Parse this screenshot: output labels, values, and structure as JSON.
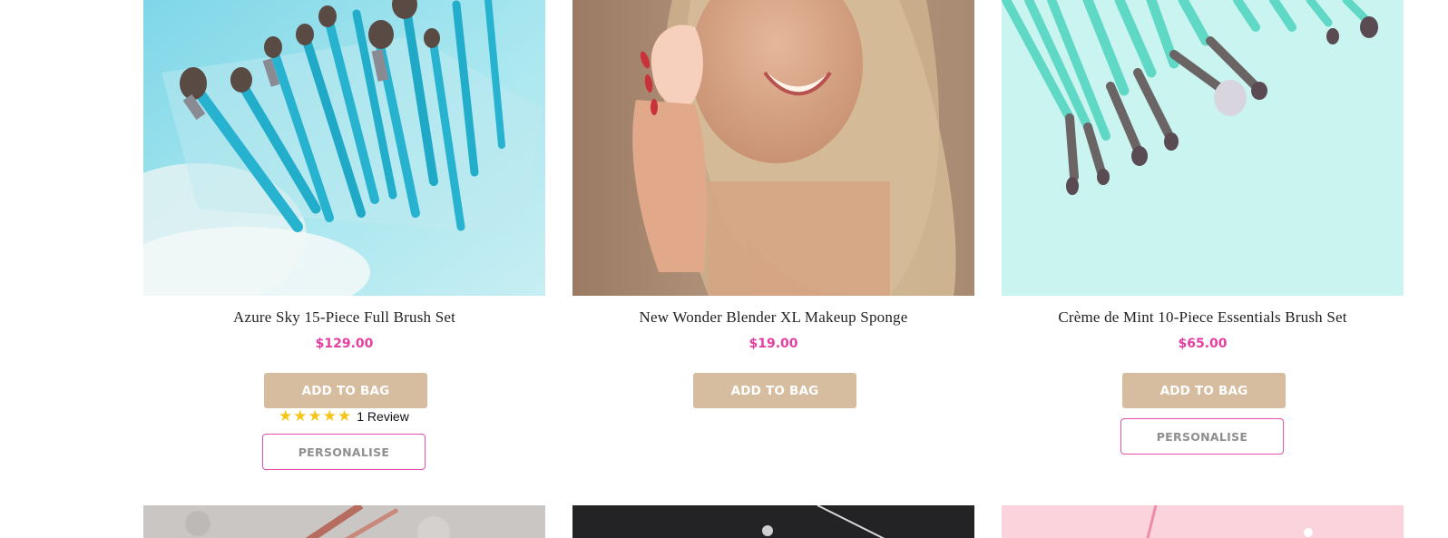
{
  "products": [
    {
      "title": "Azure Sky 15-Piece Full Brush Set",
      "price": "$129.00",
      "add_label": "ADD TO BAG",
      "personalise_label": "PERSONALISE",
      "rating": {
        "stars": 5,
        "max": 5,
        "text": "1 Review"
      },
      "image": "brush-set-azure-photo"
    },
    {
      "title": "New Wonder Blender XL Makeup Sponge",
      "price": "$19.00",
      "add_label": "ADD TO BAG",
      "image": "model-with-sponge-photo"
    },
    {
      "title": "Crème de Mint 10-Piece Essentials Brush Set",
      "price": "$65.00",
      "add_label": "ADD TO BAG",
      "personalise_label": "PERSONALISE",
      "image": "brush-set-mint-photo"
    }
  ],
  "next_row_images": [
    "grey-stone-brush-photo",
    "dark-background-photo",
    "pink-background-photo"
  ],
  "colors": {
    "price": "#e53fa1",
    "add_button": "#d6bd9f",
    "personalise_border": "#e54fae",
    "star": "#f5c518"
  }
}
